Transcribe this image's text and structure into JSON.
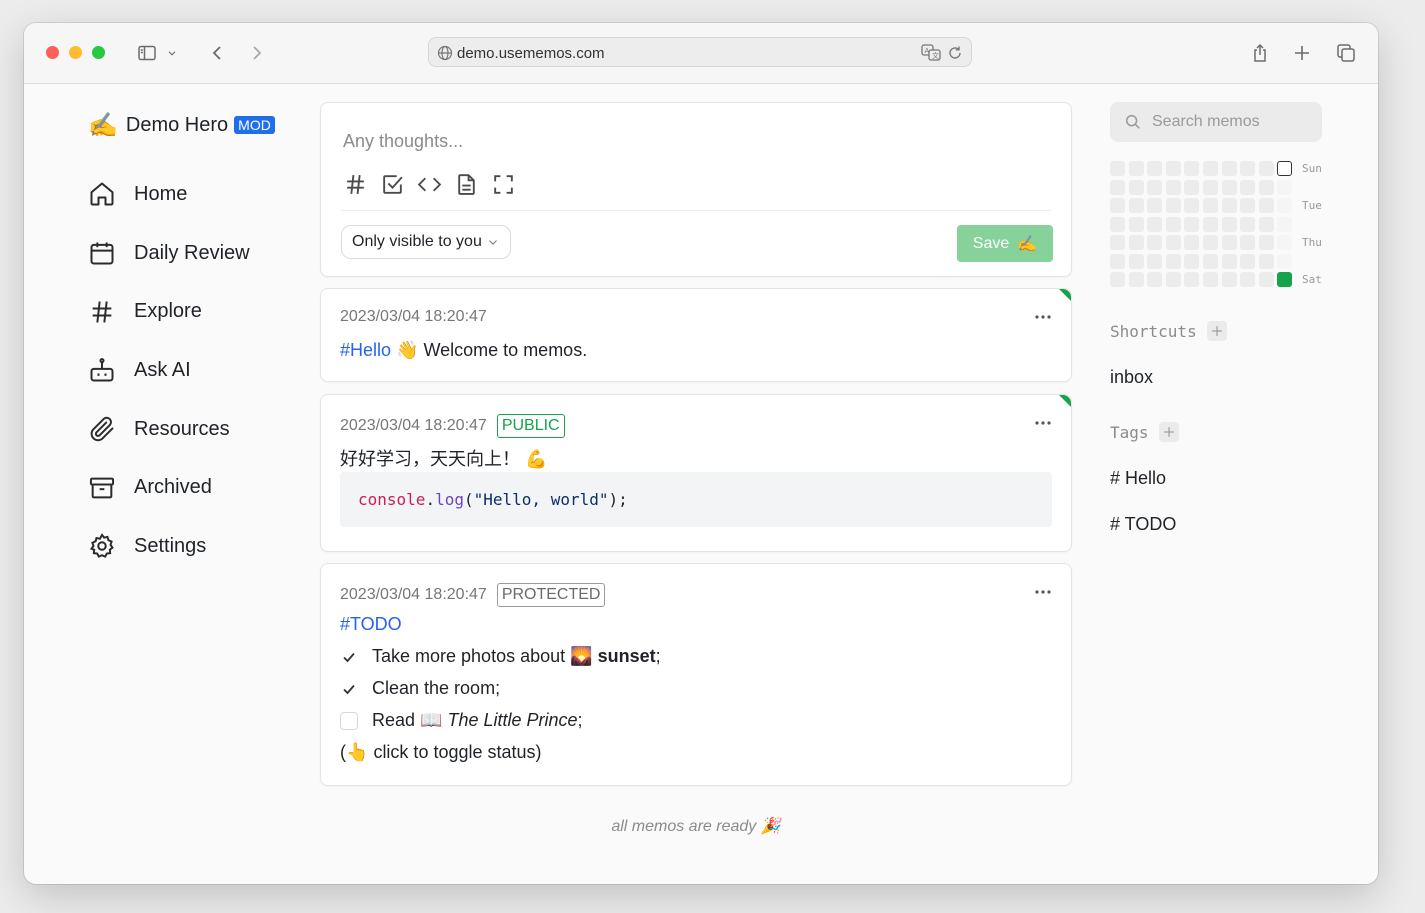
{
  "browser": {
    "url": "demo.usememos.com"
  },
  "brand": {
    "emoji": "✍️",
    "name": "Demo Hero",
    "badge": "MOD"
  },
  "nav": [
    {
      "label": "Home",
      "icon": "home-icon"
    },
    {
      "label": "Daily Review",
      "icon": "calendar-icon"
    },
    {
      "label": "Explore",
      "icon": "hash-icon"
    },
    {
      "label": "Ask AI",
      "icon": "bot-icon"
    },
    {
      "label": "Resources",
      "icon": "paperclip-icon"
    },
    {
      "label": "Archived",
      "icon": "archive-icon"
    },
    {
      "label": "Settings",
      "icon": "gear-icon"
    }
  ],
  "editor": {
    "placeholder": "Any thoughts...",
    "visibility": "Only visible to you",
    "save_label": "Save",
    "save_emoji": "✍️"
  },
  "memos": [
    {
      "timestamp": "2023/03/04 18:20:47",
      "tag": "#Hello",
      "emoji": "👋",
      "text": "Welcome to memos."
    },
    {
      "timestamp": "2023/03/04 18:20:47",
      "badge": "PUBLIC",
      "text": "好好学习，天天向上！",
      "emoji": "💪",
      "code": {
        "obj": "console",
        "dot": ".",
        "fn": "log",
        "open": "(",
        "str": "\"Hello, world\"",
        "close": ");"
      }
    },
    {
      "timestamp": "2023/03/04 18:20:47",
      "badge": "PROTECTED",
      "tag": "#TODO",
      "tasks": [
        {
          "done": true,
          "pre": "Take more photos about",
          "emoji": "🌄",
          "bold": "sunset",
          "post": ";"
        },
        {
          "done": true,
          "pre": "Clean the room;"
        },
        {
          "done": false,
          "pre": "Read",
          "emoji": "📖",
          "italic": "The Little Prince",
          "post": ";"
        }
      ],
      "note_open": "(",
      "note_emoji": "👆",
      "note_text": "click to toggle status)"
    }
  ],
  "footer_note": "all memos are ready",
  "footer_emoji": "🎉",
  "search": {
    "placeholder": "Search memos"
  },
  "heatmap": {
    "day_labels": [
      "Sun",
      "Tue",
      "Thu",
      "Sat"
    ]
  },
  "shortcuts": {
    "title": "Shortcuts",
    "items": [
      "inbox"
    ]
  },
  "tags": {
    "title": "Tags",
    "items": [
      "# Hello",
      "# TODO"
    ]
  },
  "colors": {
    "accent": "#16a34a",
    "link": "#2563eb",
    "brand_badge": "#1f6feb"
  }
}
